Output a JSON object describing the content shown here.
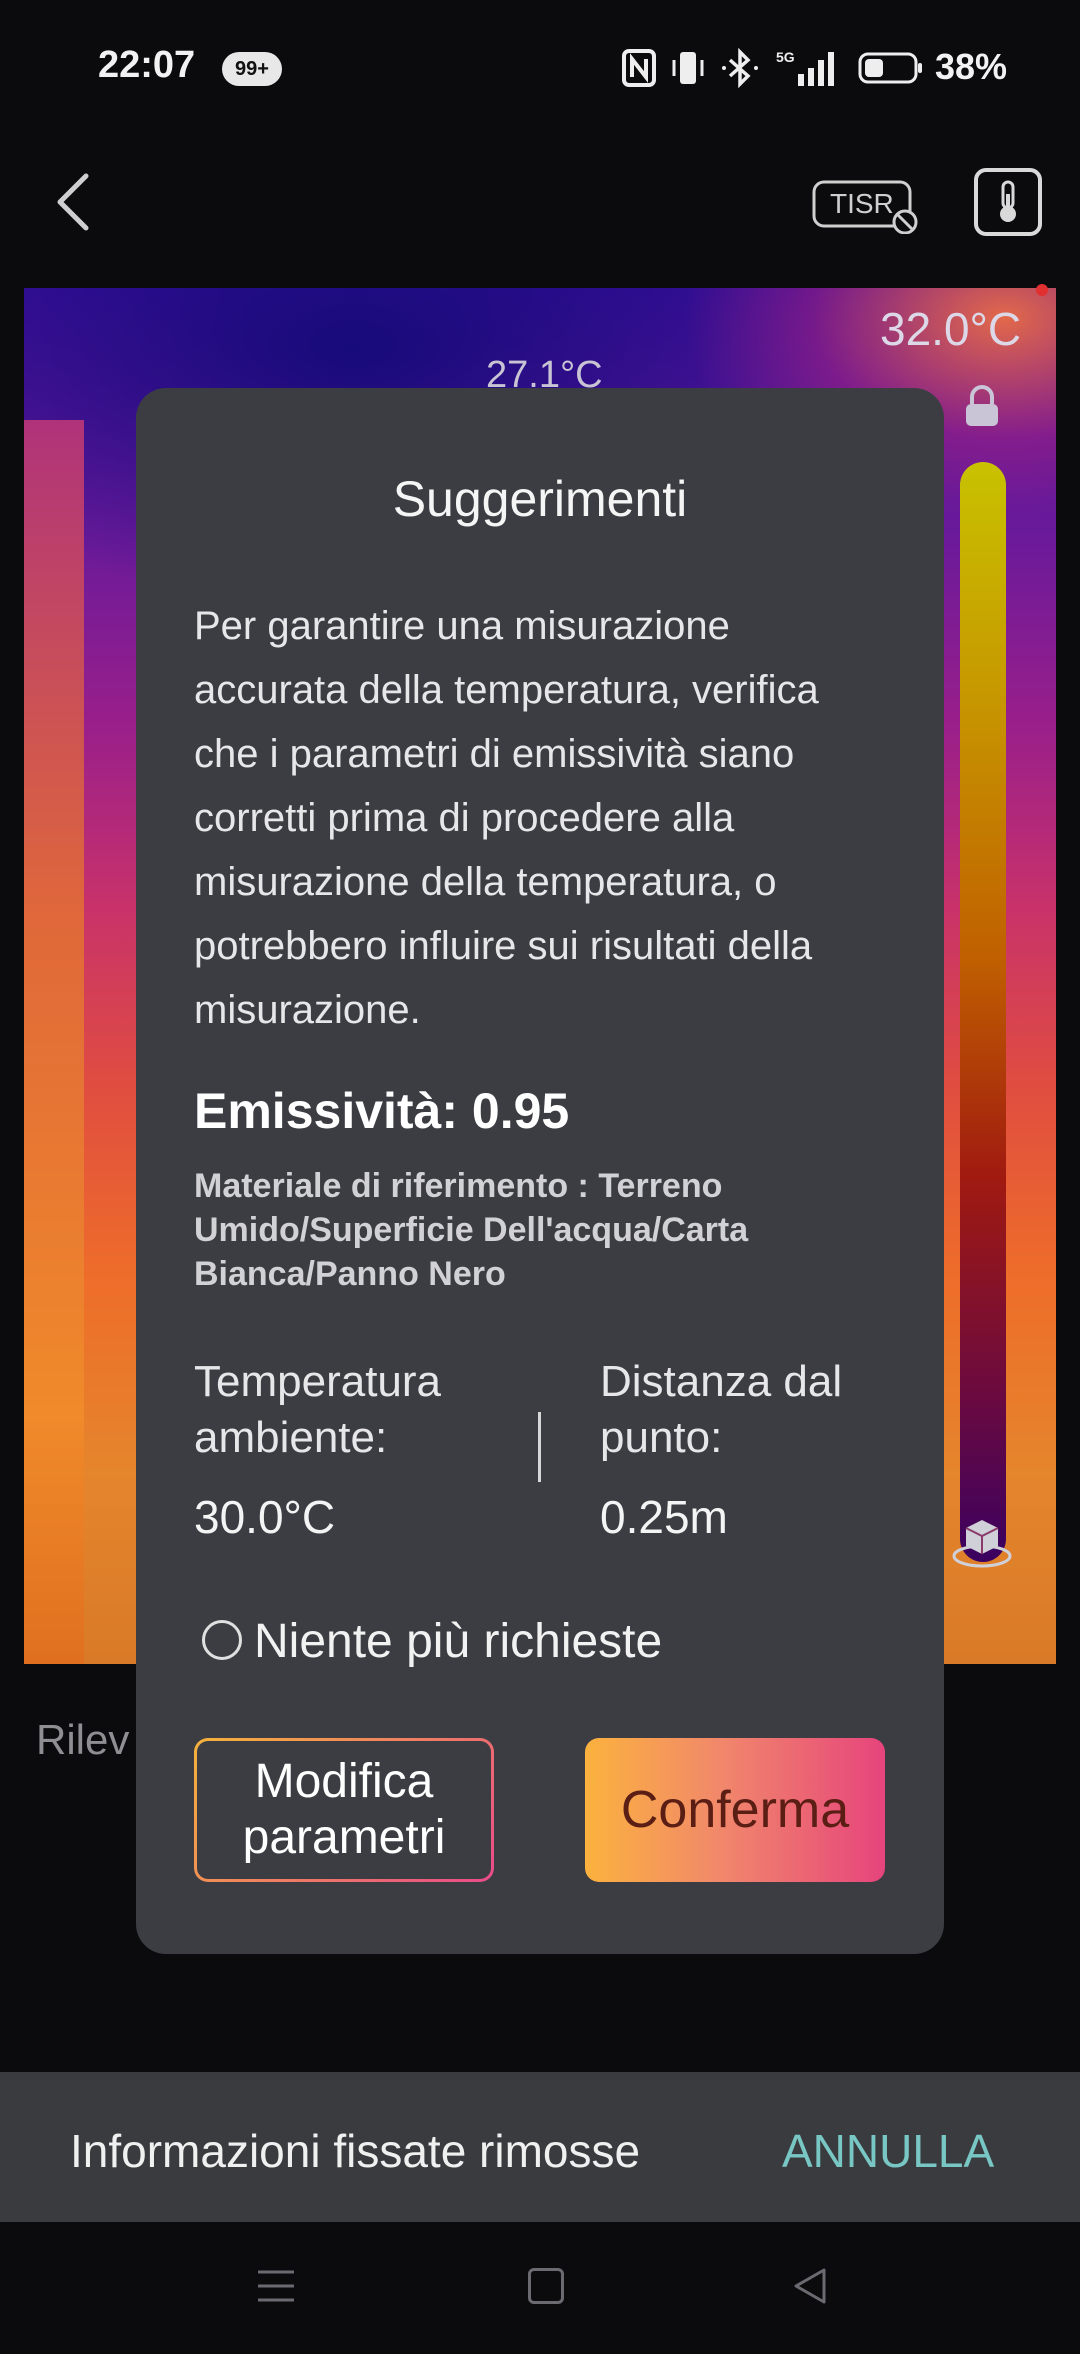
{
  "status_bar": {
    "time": "22:07",
    "notification_badge": "99+",
    "icons": [
      "nfc-icon",
      "vibrate-icon",
      "bluetooth-icon",
      "5g-signal-icon",
      "battery-icon"
    ],
    "battery": "38%"
  },
  "header": {
    "back_icon": "chevron-left-icon",
    "tisr_label": "TISR",
    "thermometer_icon": "thermometer-icon"
  },
  "thermal_view": {
    "max_temp": "32.0°C",
    "spot_temp": "27.1°C"
  },
  "background": {
    "rileva_label": "Rilev"
  },
  "dialog": {
    "title": "Suggerimenti",
    "body": "Per garantire una misurazione accurata della temperatura, verifica che i parametri di emissività siano corretti prima di procedere alla misurazione della temperatura, o potrebbero influire sui risultati della misurazione.",
    "emissivity": "Emissività: 0.95",
    "reference_material": "Materiale di riferimento : Terreno Umido/Superficie Dell'acqua/Carta Bianca/Panno Nero",
    "ambient_label": "Temperatura ambiente:",
    "ambient_value": "30.0°C",
    "distance_label": "Distanza dal punto:",
    "distance_value": "0.25m",
    "no_more_label": "Niente più richieste",
    "modify_button": "Modifica parametri",
    "confirm_button": "Conferma"
  },
  "snackbar": {
    "message": "Informazioni fissate rimosse",
    "action": "ANNULLA"
  },
  "colors": {
    "dialog_bg": "#3c3d43",
    "confirm_gradient_start": "#fbb23e",
    "confirm_gradient_end": "#e6447c",
    "snackbar_action": "#79c7c4"
  }
}
